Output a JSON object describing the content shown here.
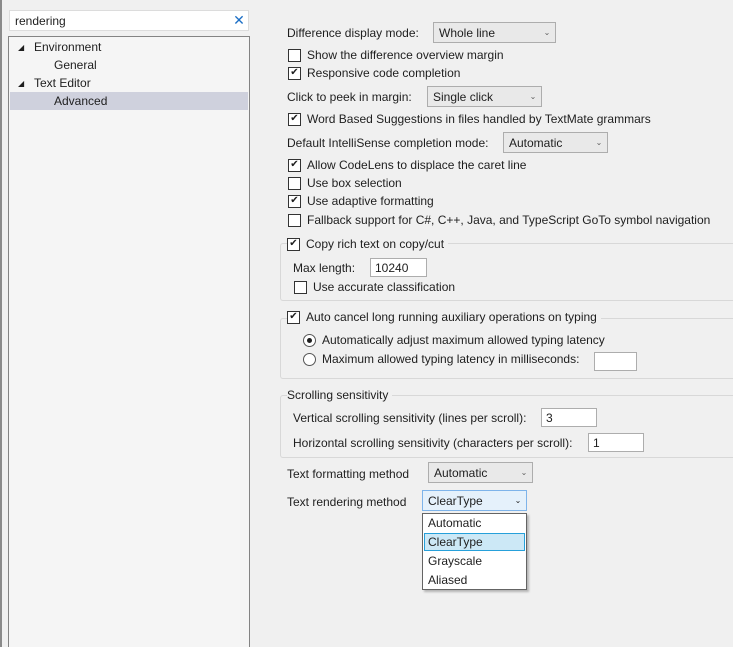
{
  "search": {
    "value": "rendering",
    "clear_icon": "close-icon"
  },
  "tree": {
    "items": [
      {
        "label": "Environment",
        "level": 0,
        "expanded": true
      },
      {
        "label": "General",
        "level": 1
      },
      {
        "label": "Text Editor",
        "level": 0,
        "expanded": true
      },
      {
        "label": "Advanced",
        "level": 1,
        "selected": true
      }
    ],
    "expand_glyph": "◢"
  },
  "options": {
    "difference_display_mode": {
      "label": "Difference display mode:",
      "value": "Whole line"
    },
    "show_difference_overview_margin": {
      "label": "Show the difference overview margin",
      "checked": false
    },
    "responsive_code_completion": {
      "label": "Responsive code completion",
      "checked": true
    },
    "click_to_peek": {
      "label": "Click to peek in margin:",
      "value": "Single click"
    },
    "word_based_suggestions": {
      "label": "Word Based Suggestions in files handled by TextMate grammars",
      "checked": true
    },
    "intellisense_mode": {
      "label": "Default IntelliSense completion mode:",
      "value": "Automatic"
    },
    "allow_codelens": {
      "label": "Allow CodeLens to displace the caret line",
      "checked": true
    },
    "box_selection": {
      "label": "Use box selection",
      "checked": false
    },
    "adaptive_formatting": {
      "label": "Use adaptive formatting",
      "checked": true
    },
    "fallback_goto": {
      "label": "Fallback support for C#, C++, Java, and TypeScript GoTo symbol navigation",
      "checked": false
    },
    "copy_rich_text": {
      "label": "Copy rich text on copy/cut",
      "checked": true,
      "max_length_label": "Max length:",
      "max_length": "10240",
      "accurate_classification": {
        "label": "Use accurate classification",
        "checked": false
      }
    },
    "auto_cancel": {
      "label": "Auto cancel long running auxiliary operations on typing",
      "checked": true,
      "radio_auto": {
        "label": "Automatically adjust maximum allowed typing latency",
        "selected": true
      },
      "radio_max": {
        "label": "Maximum allowed typing latency in milliseconds:",
        "selected": false,
        "value": ""
      }
    },
    "scrolling": {
      "title": "Scrolling sensitivity",
      "vertical_label": "Vertical scrolling sensitivity (lines per scroll):",
      "vertical_value": "3",
      "horizontal_label": "Horizontal scrolling sensitivity (characters per scroll):",
      "horizontal_value": "1"
    },
    "text_formatting_method": {
      "label": "Text formatting method",
      "value": "Automatic"
    },
    "text_rendering_method": {
      "label": "Text rendering method",
      "value": "ClearType",
      "options": [
        "Automatic",
        "ClearType",
        "Grayscale",
        "Aliased"
      ],
      "highlighted": "ClearType"
    }
  },
  "glyphs": {
    "check": "✔",
    "chevron": "⌄"
  }
}
